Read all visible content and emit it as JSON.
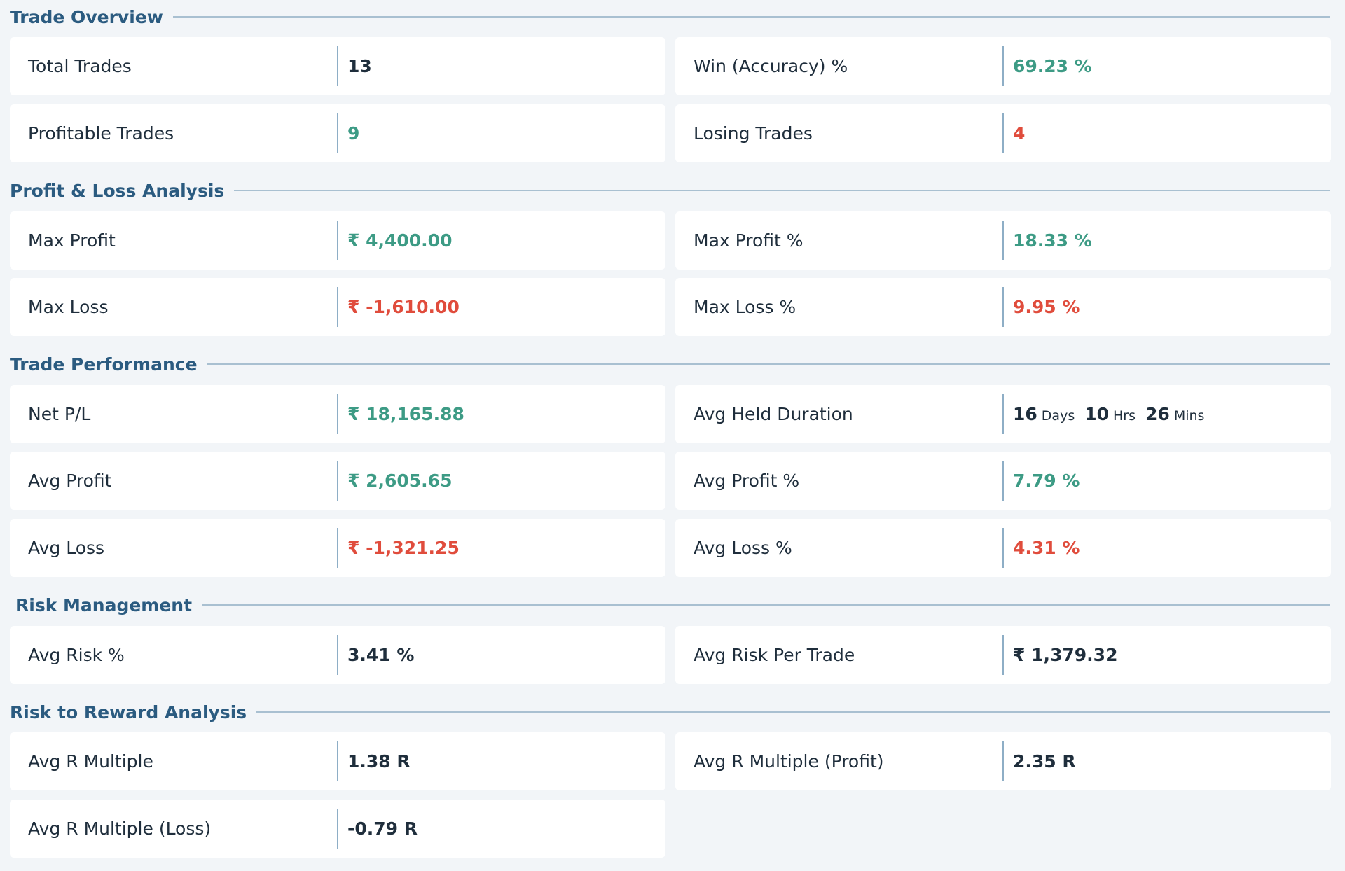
{
  "sections": {
    "trade_overview": "Trade Overview",
    "pnl_analysis": "Profit & Loss Analysis",
    "trade_performance": "Trade Performance",
    "risk_management": "Risk Management",
    "risk_reward": "Risk to Reward Analysis"
  },
  "metrics": {
    "total_trades": {
      "label": "Total Trades",
      "value": "13"
    },
    "win_accuracy": {
      "label": "Win (Accuracy) %",
      "value": "69.23 %"
    },
    "profitable_trades": {
      "label": "Profitable Trades",
      "value": "9"
    },
    "losing_trades": {
      "label": "Losing Trades",
      "value": "4"
    },
    "max_profit": {
      "label": "Max Profit",
      "value": "₹ 4,400.00"
    },
    "max_profit_pct": {
      "label": "Max Profit %",
      "value": "18.33 %"
    },
    "max_loss": {
      "label": "Max Loss",
      "value": "₹ -1,610.00"
    },
    "max_loss_pct": {
      "label": "Max Loss %",
      "value": "9.95 %"
    },
    "net_pl": {
      "label": "Net P/L",
      "value": "₹ 18,165.88"
    },
    "avg_held_duration": {
      "label": "Avg Held Duration",
      "days": "16",
      "days_unit": "Days",
      "hrs": "10",
      "hrs_unit": "Hrs",
      "mins": "26",
      "mins_unit": "Mins"
    },
    "avg_profit": {
      "label": "Avg Profit",
      "value": "₹ 2,605.65"
    },
    "avg_profit_pct": {
      "label": "Avg Profit %",
      "value": "7.79 %"
    },
    "avg_loss": {
      "label": "Avg Loss",
      "value": "₹ -1,321.25"
    },
    "avg_loss_pct": {
      "label": "Avg Loss %",
      "value": "4.31 %"
    },
    "avg_risk_pct": {
      "label": "Avg Risk %",
      "value": "3.41 %"
    },
    "avg_risk_per_trade": {
      "label": "Avg Risk Per Trade",
      "value": "₹ 1,379.32"
    },
    "avg_r_multiple": {
      "label": "Avg R Multiple",
      "value": "1.38 R"
    },
    "avg_r_multiple_profit": {
      "label": "Avg R Multiple (Profit)",
      "value": "2.35 R"
    },
    "avg_r_multiple_loss": {
      "label": "Avg R Multiple (Loss)",
      "value": "-0.79 R"
    }
  },
  "colors": {
    "positive": "#3d9b85",
    "negative": "#e04c3c",
    "neutral": "#1f2e3c",
    "section_title": "#2b5b80",
    "background": "#f2f5f8"
  }
}
